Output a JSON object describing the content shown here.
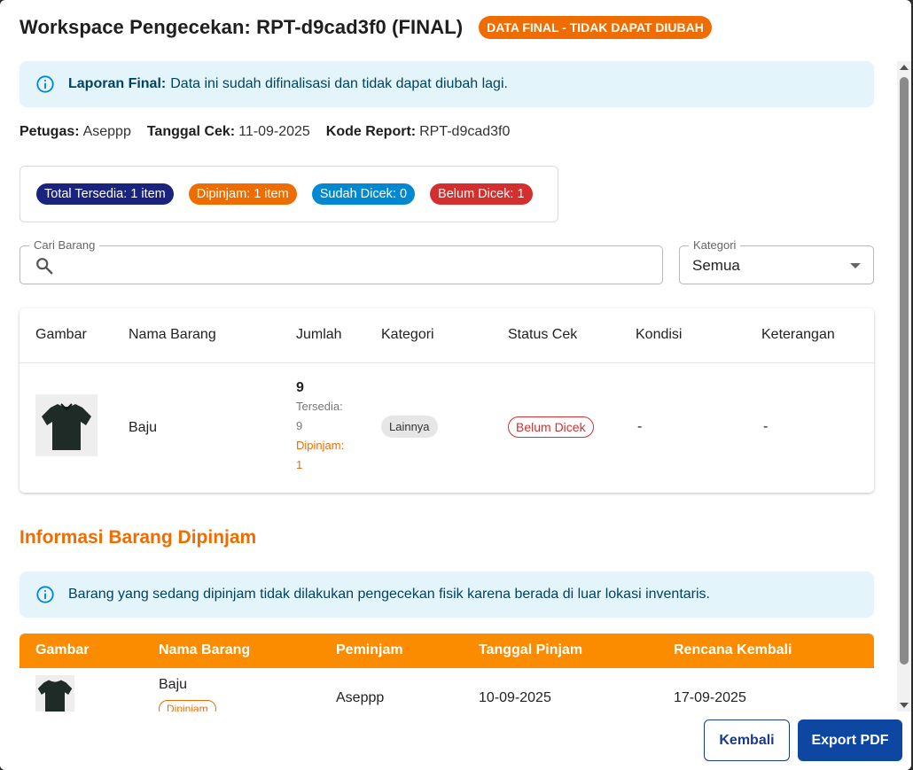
{
  "header": {
    "title": "Workspace Pengecekan: RPT-d9cad3f0 (FINAL)",
    "final_badge": "DATA FINAL - TIDAK DAPAT DIUBAH"
  },
  "final_alert": {
    "bold": "Laporan Final:",
    "text": "Data ini sudah difinalisasi dan tidak dapat diubah lagi."
  },
  "meta": {
    "petugas_label": "Petugas:",
    "petugas_value": "Aseppp",
    "tanggal_label": "Tanggal Cek:",
    "tanggal_value": "11-09-2025",
    "kode_label": "Kode Report:",
    "kode_value": "RPT-d9cad3f0"
  },
  "summary": {
    "total": "Total Tersedia: 1 item",
    "dipinjam": "Dipinjam: 1 item",
    "sudah": "Sudah Dicek: 0",
    "belum": "Belum Dicek: 1"
  },
  "search": {
    "legend": "Cari Barang",
    "value": ""
  },
  "category_filter": {
    "legend": "Kategori",
    "value": "Semua"
  },
  "items_table": {
    "headers": [
      "Gambar",
      "Nama Barang",
      "Jumlah",
      "Kategori",
      "Status Cek",
      "Kondisi",
      "Keterangan"
    ],
    "rows": [
      {
        "nama": "Baju",
        "jumlah": "9",
        "tersedia_label": "Tersedia:",
        "tersedia_value": "9",
        "dipinjam_label": "Dipinjam:",
        "dipinjam_value": "1",
        "kategori": "Lainnya",
        "status": "Belum Dicek",
        "kondisi": "-",
        "keterangan": "-"
      }
    ]
  },
  "loan_section": {
    "title": "Informasi Barang Dipinjam",
    "alert": "Barang yang sedang dipinjam tidak dilakukan pengecekan fisik karena berada di luar lokasi inventaris.",
    "headers": [
      "Gambar",
      "Nama Barang",
      "Peminjam",
      "Tanggal Pinjam",
      "Rencana Kembali"
    ],
    "rows": [
      {
        "nama": "Baju",
        "badge": "Dipinjam",
        "peminjam": "Aseppp",
        "tanggal_pinjam": "10-09-2025",
        "rencana_kembali": "17-09-2025"
      }
    ]
  },
  "footer": {
    "back_label": "Kembali",
    "export_label": "Export PDF"
  },
  "colors": {
    "accent_orange": "#ef6c00",
    "navy": "#1a237e",
    "info_blue": "#0288d1",
    "error_red": "#d32f2f",
    "primary_button": "#0d47a1"
  }
}
